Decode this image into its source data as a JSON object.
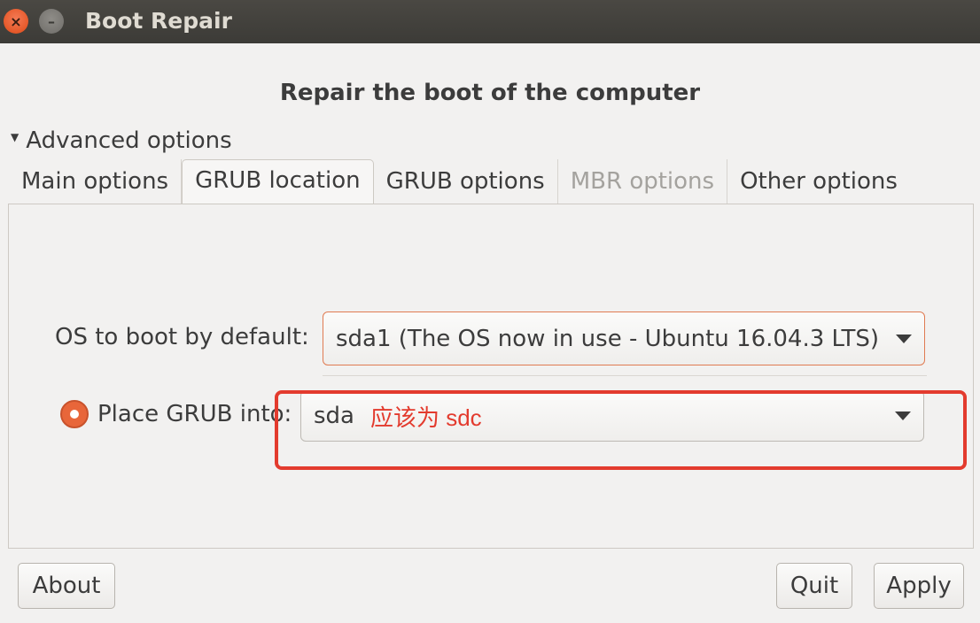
{
  "window": {
    "title": "Boot Repair",
    "close_glyph": "×",
    "minimize_glyph": "–"
  },
  "heading": "Repair the boot of the computer",
  "expander": {
    "label": "Advanced options",
    "expanded": true
  },
  "tabs": [
    {
      "label": "Main options",
      "active": false,
      "disabled": false
    },
    {
      "label": "GRUB location",
      "active": true,
      "disabled": false
    },
    {
      "label": "GRUB options",
      "active": false,
      "disabled": false
    },
    {
      "label": "MBR options",
      "active": false,
      "disabled": true
    },
    {
      "label": "Other options",
      "active": false,
      "disabled": false
    }
  ],
  "grub_location": {
    "os_label": "OS to boot by default:",
    "os_value": "sda1 (The OS now in use - Ubuntu 16.04.3 LTS)",
    "place_label": "Place GRUB into:",
    "place_value": "sda",
    "place_selected": true
  },
  "annotation": {
    "text": "应该为 sdc",
    "color": "#e33b2e"
  },
  "buttons": {
    "about": "About",
    "quit": "Quit",
    "apply": "Apply"
  },
  "colors": {
    "accent": "#e8663a",
    "titlebar": "#3c3b37"
  }
}
